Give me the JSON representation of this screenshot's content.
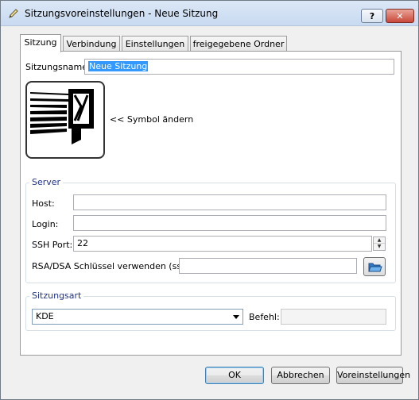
{
  "window": {
    "title": "Sitzungsvoreinstellungen - Neue Sitzung",
    "help_label": "?",
    "close_label": "✕"
  },
  "tabs": [
    {
      "label": "Sitzung",
      "active": true
    },
    {
      "label": "Verbindung",
      "active": false
    },
    {
      "label": "Einstellungen",
      "active": false
    },
    {
      "label": "freigegebene Ordner",
      "active": false
    }
  ],
  "session": {
    "name_label": "Sitzungsname:",
    "name_value": "Neue Sitzung",
    "change_icon_label": "<< Symbol ändern"
  },
  "server": {
    "group_title": "Server",
    "host_label": "Host:",
    "host_value": "",
    "login_label": "Login:",
    "login_value": "",
    "ssh_port_label": "SSH Port:",
    "ssh_port_value": "22",
    "rsa_label": "RSA/DSA Schlüssel verwenden (ssh):",
    "rsa_value": ""
  },
  "session_type": {
    "group_title": "Sitzungsart",
    "selected": "KDE",
    "command_label": "Befehl:",
    "command_value": ""
  },
  "buttons": {
    "ok": "OK",
    "cancel": "Abbrechen",
    "defaults": "Voreinstellungen"
  }
}
